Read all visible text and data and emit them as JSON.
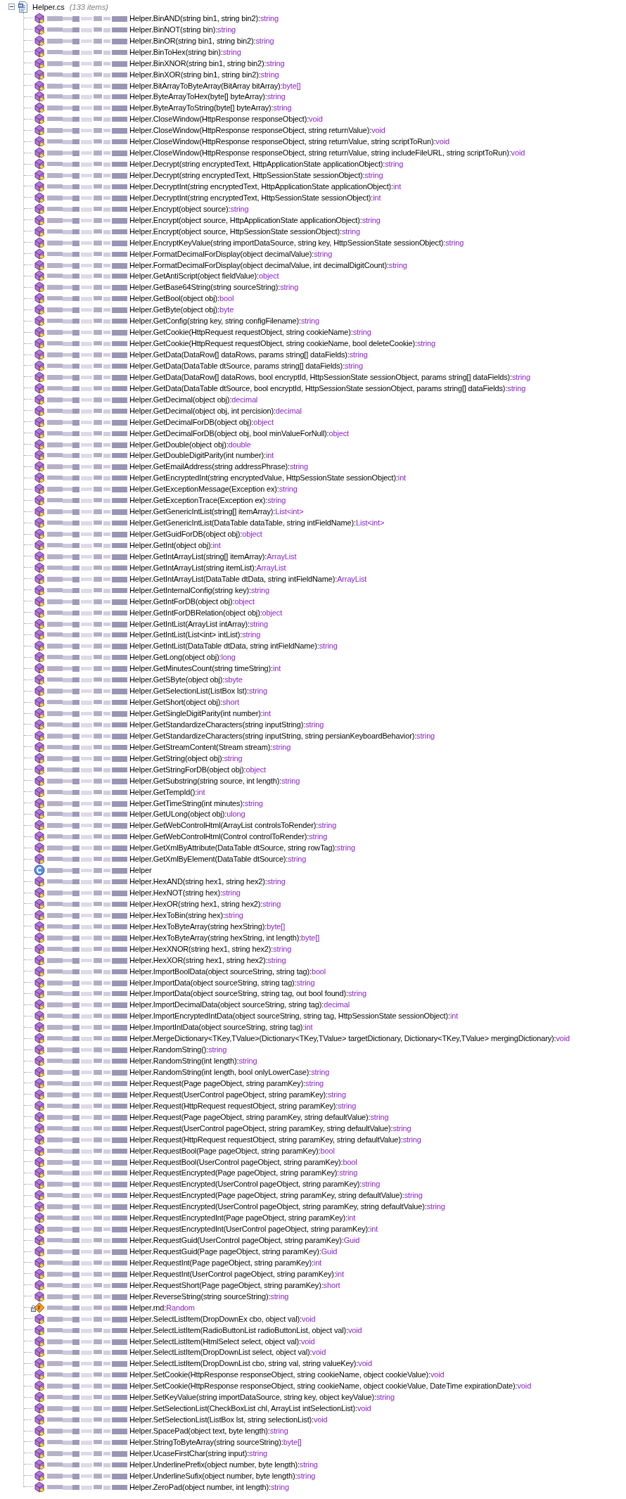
{
  "file": {
    "name": "Helper.cs",
    "item_count": "(133 items)",
    "expanded": true
  },
  "members": [
    {
      "kind": "method",
      "signature": "Helper.BinAND(string bin1, string bin2):",
      "type": "string"
    },
    {
      "kind": "method",
      "signature": "Helper.BinNOT(string bin):",
      "type": "string"
    },
    {
      "kind": "method",
      "signature": "Helper.BinOR(string bin1, string bin2):",
      "type": "string"
    },
    {
      "kind": "method",
      "signature": "Helper.BinToHex(string bin):",
      "type": "string"
    },
    {
      "kind": "method",
      "signature": "Helper.BinXNOR(string bin1, string bin2):",
      "type": "string"
    },
    {
      "kind": "method",
      "signature": "Helper.BinXOR(string bin1, string bin2):",
      "type": "string"
    },
    {
      "kind": "method",
      "signature": "Helper.BitArrayToByteArray(BitArray bitArray):",
      "type": "byte[]"
    },
    {
      "kind": "method",
      "signature": "Helper.ByteArrayToHex(byte[] byteArray):",
      "type": "string"
    },
    {
      "kind": "method",
      "signature": "Helper.ByteArrayToString(byte[] byteArray):",
      "type": "string"
    },
    {
      "kind": "method",
      "signature": "Helper.CloseWindow(HttpResponse responseObject):",
      "type": "void"
    },
    {
      "kind": "method",
      "signature": "Helper.CloseWindow(HttpResponse responseObject, string returnValue):",
      "type": "void"
    },
    {
      "kind": "method",
      "signature": "Helper.CloseWindow(HttpResponse responseObject, string returnValue, string scriptToRun):",
      "type": "void"
    },
    {
      "kind": "method",
      "signature": "Helper.CloseWindow(HttpResponse responseObject, string returnValue, string includeFileURL, string scriptToRun):",
      "type": "void"
    },
    {
      "kind": "method",
      "signature": "Helper.Decrypt(string encryptedText, HttpApplicationState applicationObject):",
      "type": "string"
    },
    {
      "kind": "method",
      "signature": "Helper.Decrypt(string encryptedText, HttpSessionState sessionObject):",
      "type": "string"
    },
    {
      "kind": "method",
      "signature": "Helper.DecryptInt(string encryptedText, HttpApplicationState applicationObject):",
      "type": "int"
    },
    {
      "kind": "method",
      "signature": "Helper.DecryptInt(string encryptedText, HttpSessionState sessionObject):",
      "type": "int"
    },
    {
      "kind": "method",
      "signature": "Helper.Encrypt(object source):",
      "type": "string"
    },
    {
      "kind": "method",
      "signature": "Helper.Encrypt(object source, HttpApplicationState applicationObject):",
      "type": "string"
    },
    {
      "kind": "method",
      "signature": "Helper.Encrypt(object source, HttpSessionState sessionObject):",
      "type": "string"
    },
    {
      "kind": "method",
      "signature": "Helper.EncryptKeyValue(string importDataSource, string key, HttpSessionState sessionObject):",
      "type": "string"
    },
    {
      "kind": "method",
      "signature": "Helper.FormatDecimalForDisplay(object decimalValue):",
      "type": "string"
    },
    {
      "kind": "method",
      "signature": "Helper.FormatDecimalForDisplay(object decimalValue, int decimalDigitCount):",
      "type": "string"
    },
    {
      "kind": "method",
      "signature": "Helper.GetAntiScript(object fieldValue):",
      "type": "object"
    },
    {
      "kind": "method",
      "signature": "Helper.GetBase64String(string sourceString):",
      "type": "string"
    },
    {
      "kind": "method",
      "signature": "Helper.GetBool(object obj):",
      "type": "bool"
    },
    {
      "kind": "method",
      "signature": "Helper.GetByte(object obj):",
      "type": "byte"
    },
    {
      "kind": "method",
      "signature": "Helper.GetConfig(string key, string configFilename):",
      "type": "string"
    },
    {
      "kind": "method",
      "signature": "Helper.GetCookie(HttpRequest requestObject, string cookieName):",
      "type": "string"
    },
    {
      "kind": "method",
      "signature": "Helper.GetCookie(HttpRequest requestObject, string cookieName, bool deleteCookie):",
      "type": "string"
    },
    {
      "kind": "method",
      "signature": "Helper.GetData(DataRow[] dataRows, params string[] dataFields):",
      "type": "string"
    },
    {
      "kind": "method",
      "signature": "Helper.GetData(DataTable dtSource, params string[] dataFields):",
      "type": "string"
    },
    {
      "kind": "method",
      "signature": "Helper.GetData(DataRow[] dataRows, bool encryptId, HttpSessionState sessionObject, params string[] dataFields):",
      "type": "string"
    },
    {
      "kind": "method",
      "signature": "Helper.GetData(DataTable dtSource, bool encryptId, HttpSessionState sessionObject, params string[] dataFields):",
      "type": "string"
    },
    {
      "kind": "method",
      "signature": "Helper.GetDecimal(object obj):",
      "type": "decimal"
    },
    {
      "kind": "method",
      "signature": "Helper.GetDecimal(object obj, int percision):",
      "type": "decimal"
    },
    {
      "kind": "method",
      "signature": "Helper.GetDecimalForDB(object obj):",
      "type": "object"
    },
    {
      "kind": "method",
      "signature": "Helper.GetDecimalForDB(object obj, bool minValueForNull):",
      "type": "object"
    },
    {
      "kind": "method",
      "signature": "Helper.GetDouble(object obj):",
      "type": "double"
    },
    {
      "kind": "method",
      "signature": "Helper.GetDoubleDigitParity(int number):",
      "type": "int"
    },
    {
      "kind": "method",
      "signature": "Helper.GetEmailAddress(string addressPhrase):",
      "type": "string"
    },
    {
      "kind": "method",
      "signature": "Helper.GetEncryptedInt(string encryptedValue, HttpSessionState sessionObject):",
      "type": "int"
    },
    {
      "kind": "method",
      "signature": "Helper.GetExceptionMessage(Exception ex):",
      "type": "string"
    },
    {
      "kind": "method",
      "signature": "Helper.GetExceptionTrace(Exception ex):",
      "type": "string"
    },
    {
      "kind": "method",
      "signature": "Helper.GetGenericIntList(string[] itemArray):",
      "type": "List<int>"
    },
    {
      "kind": "method",
      "signature": "Helper.GetGenericIntList(DataTable dataTable, string intFieldName):",
      "type": "List<int>"
    },
    {
      "kind": "method",
      "signature": "Helper.GetGuidForDB(object obj):",
      "type": "object"
    },
    {
      "kind": "method",
      "signature": "Helper.GetInt(object obj):",
      "type": "int"
    },
    {
      "kind": "method",
      "signature": "Helper.GetIntArrayList(string[] itemArray):",
      "type": "ArrayList"
    },
    {
      "kind": "method",
      "signature": "Helper.GetIntArrayList(string itemList):",
      "type": "ArrayList"
    },
    {
      "kind": "method",
      "signature": "Helper.GetIntArrayList(DataTable dtData, string intFieldName):",
      "type": "ArrayList"
    },
    {
      "kind": "method",
      "signature": "Helper.GetInternalConfig(string key):",
      "type": "string"
    },
    {
      "kind": "method",
      "signature": "Helper.GetIntForDB(object obj):",
      "type": "object"
    },
    {
      "kind": "method",
      "signature": "Helper.GetIntForDBRelation(object obj):",
      "type": "object"
    },
    {
      "kind": "method",
      "signature": "Helper.GetIntList(ArrayList intArray):",
      "type": "string"
    },
    {
      "kind": "method",
      "signature": "Helper.GetIntList(List<int> intList):",
      "type": "string"
    },
    {
      "kind": "method",
      "signature": "Helper.GetIntList(DataTable dtData, string intFieldName):",
      "type": "string"
    },
    {
      "kind": "method",
      "signature": "Helper.GetLong(object obj):",
      "type": "long"
    },
    {
      "kind": "method",
      "signature": "Helper.GetMinutesCount(string timeString):",
      "type": "int"
    },
    {
      "kind": "method",
      "signature": "Helper.GetSByte(object obj):",
      "type": "sbyte"
    },
    {
      "kind": "method",
      "signature": "Helper.GetSelectionList(ListBox lst):",
      "type": "string"
    },
    {
      "kind": "method",
      "signature": "Helper.GetShort(object obj):",
      "type": "short"
    },
    {
      "kind": "method",
      "signature": "Helper.GetSingleDigitParity(int number):",
      "type": "int"
    },
    {
      "kind": "method",
      "signature": "Helper.GetStandardizeCharacters(string inputString):",
      "type": "string"
    },
    {
      "kind": "method",
      "signature": "Helper.GetStandardizeCharacters(string inputString, string persianKeyboardBehavior):",
      "type": "string"
    },
    {
      "kind": "method",
      "signature": "Helper.GetStreamContent(Stream stream):",
      "type": "string"
    },
    {
      "kind": "method",
      "signature": "Helper.GetString(object obj):",
      "type": "string"
    },
    {
      "kind": "method",
      "signature": "Helper.GetStringForDB(object obj):",
      "type": "object"
    },
    {
      "kind": "method",
      "signature": "Helper.GetSubstring(string source, int length):",
      "type": "string"
    },
    {
      "kind": "method",
      "signature": "Helper.GetTempId():",
      "type": "int"
    },
    {
      "kind": "method",
      "signature": "Helper.GetTimeString(int minutes):",
      "type": "string"
    },
    {
      "kind": "method",
      "signature": "Helper.GetULong(object obj):",
      "type": "ulong"
    },
    {
      "kind": "method",
      "signature": "Helper.GetWebControlHtml(ArrayList controlsToRender):",
      "type": "string"
    },
    {
      "kind": "method",
      "signature": "Helper.GetWebControlHtml(Control controlToRender):",
      "type": "string"
    },
    {
      "kind": "method",
      "signature": "Helper.GetXmlByAttribute(DataTable dtSource, string rowTag):",
      "type": "string"
    },
    {
      "kind": "method",
      "signature": "Helper.GetXmlByElement(DataTable dtSource):",
      "type": "string"
    },
    {
      "kind": "class",
      "signature": "Helper"
    },
    {
      "kind": "method",
      "signature": "Helper.HexAND(string hex1, string hex2):",
      "type": "string"
    },
    {
      "kind": "method",
      "signature": "Helper.HexNOT(string hex):",
      "type": "string"
    },
    {
      "kind": "method",
      "signature": "Helper.HexOR(string hex1, string hex2):",
      "type": "string"
    },
    {
      "kind": "method",
      "signature": "Helper.HexToBin(string hex):",
      "type": "string"
    },
    {
      "kind": "method",
      "signature": "Helper.HexToByteArray(string hexString):",
      "type": "byte[]"
    },
    {
      "kind": "method",
      "signature": "Helper.HexToByteArray(string hexString, int length):",
      "type": "byte[]"
    },
    {
      "kind": "method",
      "signature": "Helper.HexXNOR(string hex1, string hex2):",
      "type": "string"
    },
    {
      "kind": "method",
      "signature": "Helper.HexXOR(string hex1, string hex2):",
      "type": "string"
    },
    {
      "kind": "method",
      "signature": "Helper.ImportBoolData(object sourceString, string tag):",
      "type": "bool"
    },
    {
      "kind": "method",
      "signature": "Helper.ImportData(object sourceString, string tag):",
      "type": "string"
    },
    {
      "kind": "method",
      "signature": "Helper.ImportData(object sourceString, string tag, out bool found):",
      "type": "string"
    },
    {
      "kind": "method",
      "signature": "Helper.ImportDecimalData(object sourceString, string tag):",
      "type": "decimal"
    },
    {
      "kind": "method",
      "signature": "Helper.ImportEncryptedIntData(object sourceString, string tag, HttpSessionState sessionObject):",
      "type": "int"
    },
    {
      "kind": "method",
      "signature": "Helper.ImportIntData(object sourceString, string tag):",
      "type": "int"
    },
    {
      "kind": "method",
      "signature": "Helper.MergeDictionary<TKey,TValue>(Dictionary<TKey,TValue> targetDictionary, Dictionary<TKey,TValue> mergingDictionary):",
      "type": "void"
    },
    {
      "kind": "method",
      "signature": "Helper.RandomString():",
      "type": "string"
    },
    {
      "kind": "method",
      "signature": "Helper.RandomString(int length):",
      "type": "string"
    },
    {
      "kind": "method",
      "signature": "Helper.RandomString(int length, bool onlyLowerCase):",
      "type": "string"
    },
    {
      "kind": "method",
      "signature": "Helper.Request(Page pageObject, string paramKey):",
      "type": "string"
    },
    {
      "kind": "method",
      "signature": "Helper.Request(UserControl pageObject, string paramKey):",
      "type": "string"
    },
    {
      "kind": "method",
      "signature": "Helper.Request(HttpRequest requestObject, string paramKey):",
      "type": "string"
    },
    {
      "kind": "method",
      "signature": "Helper.Request(Page pageObject, string paramKey, string defaultValue):",
      "type": "string"
    },
    {
      "kind": "method",
      "signature": "Helper.Request(UserControl pageObject, string paramKey, string defaultValue):",
      "type": "string"
    },
    {
      "kind": "method",
      "signature": "Helper.Request(HttpRequest requestObject, string paramKey, string defaultValue):",
      "type": "string"
    },
    {
      "kind": "method",
      "signature": "Helper.RequestBool(Page pageObject, string paramKey):",
      "type": "bool"
    },
    {
      "kind": "method",
      "signature": "Helper.RequestBool(UserControl pageObject, string paramKey):",
      "type": "bool"
    },
    {
      "kind": "method",
      "signature": "Helper.RequestEncrypted(Page pageObject, string paramKey):",
      "type": "string"
    },
    {
      "kind": "method",
      "signature": "Helper.RequestEncrypted(UserControl pageObject, string paramKey):",
      "type": "string"
    },
    {
      "kind": "method",
      "signature": "Helper.RequestEncrypted(Page pageObject, string paramKey, string defaultValue):",
      "type": "string"
    },
    {
      "kind": "method",
      "signature": "Helper.RequestEncrypted(UserControl pageObject, string paramKey, string defaultValue):",
      "type": "string"
    },
    {
      "kind": "method",
      "signature": "Helper.RequestEncryptedInt(Page pageObject, string paramKey):",
      "type": "int"
    },
    {
      "kind": "method",
      "signature": "Helper.RequestEncryptedInt(UserControl pageObject, string paramKey):",
      "type": "int"
    },
    {
      "kind": "method",
      "signature": "Helper.RequestGuid(UserControl pageObject, string paramKey):",
      "type": "Guid"
    },
    {
      "kind": "method",
      "signature": "Helper.RequestGuid(Page pageObject, string paramKey):",
      "type": "Guid"
    },
    {
      "kind": "method",
      "signature": "Helper.RequestInt(Page pageObject, string paramKey):",
      "type": "int"
    },
    {
      "kind": "method",
      "signature": "Helper.RequestInt(UserControl pageObject, string paramKey):",
      "type": "int"
    },
    {
      "kind": "method",
      "signature": "Helper.RequestShort(Page pageObject, string paramKey):",
      "type": "short"
    },
    {
      "kind": "method",
      "signature": "Helper.ReverseString(string sourceString):",
      "type": "string"
    },
    {
      "kind": "field",
      "signature": "Helper.rnd:",
      "type": "Random"
    },
    {
      "kind": "method",
      "signature": "Helper.SelectListItem(DropDownEx cbo, object val):",
      "type": "void"
    },
    {
      "kind": "method",
      "signature": "Helper.SelectListItem(RadioButtonList radioButtonList, object val):",
      "type": "void"
    },
    {
      "kind": "method",
      "signature": "Helper.SelectListItem(HtmlSelect select, object val):",
      "type": "void"
    },
    {
      "kind": "method",
      "signature": "Helper.SelectListItem(DropDownList select, object val):",
      "type": "void"
    },
    {
      "kind": "method",
      "signature": "Helper.SelectListItem(DropDownList cbo, string val, string valueKey):",
      "type": "void"
    },
    {
      "kind": "method",
      "signature": "Helper.SetCookie(HttpResponse responseObject, string cookieName, object cookieValue):",
      "type": "void"
    },
    {
      "kind": "method",
      "signature": "Helper.SetCookie(HttpResponse responseObject, string cookieName, object cookieValue, DateTime expirationDate):",
      "type": "void"
    },
    {
      "kind": "method",
      "signature": "Helper.SetKeyValue(string importDataSource, string key, object keyValue):",
      "type": "string"
    },
    {
      "kind": "method",
      "signature": "Helper.SetSelectionList(CheckBoxList chl, ArrayList intSelectionList):",
      "type": "void"
    },
    {
      "kind": "method",
      "signature": "Helper.SetSelectionList(ListBox lst, string selectionList):",
      "type": "void"
    },
    {
      "kind": "method",
      "signature": "Helper.SpacePad(object text, byte length):",
      "type": "string"
    },
    {
      "kind": "method",
      "signature": "Helper.StringToByteArray(string sourceString):",
      "type": "byte[]"
    },
    {
      "kind": "method",
      "signature": "Helper.UcaseFirstChar(string input):",
      "type": "string"
    },
    {
      "kind": "method",
      "signature": "Helper.UnderlinePrefix(object number, byte length):",
      "type": "string"
    },
    {
      "kind": "method",
      "signature": "Helper.UnderlineSufix(object number, byte length):",
      "type": "string"
    },
    {
      "kind": "method",
      "signature": "Helper.ZeroPad(object number, int length):",
      "type": "string"
    }
  ]
}
